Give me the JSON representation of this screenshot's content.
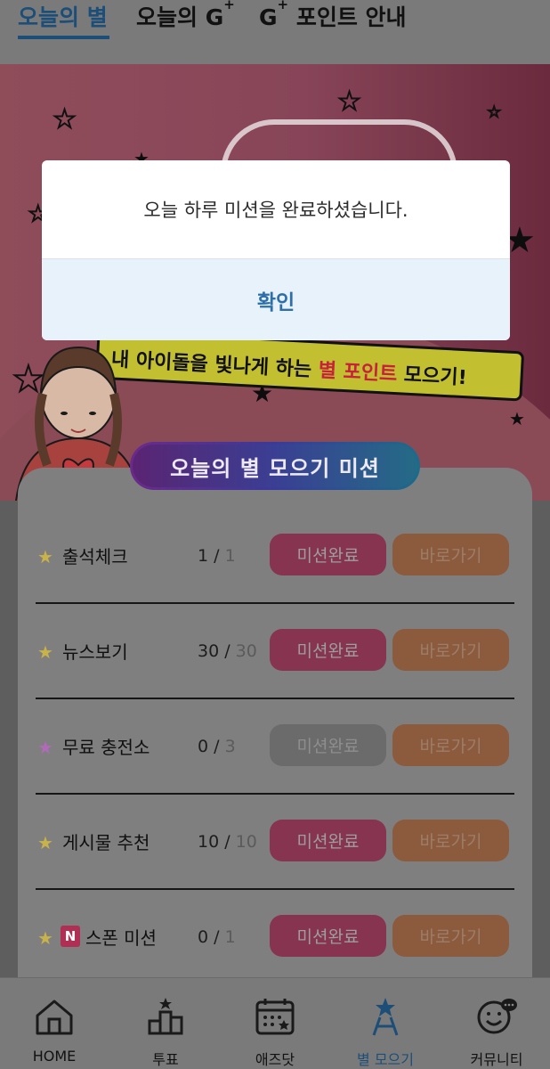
{
  "top_tabs": [
    {
      "label": "오늘의 별",
      "sup": ""
    },
    {
      "label": "오늘의 G",
      "sup": "+"
    },
    {
      "label": "G",
      "sup": "+",
      "suffix": " 포인트 안내"
    }
  ],
  "banner": {
    "slogan_prefix": "내 아이돌을 빛나게 하는 ",
    "slogan_highlight": "별 포인트",
    "slogan_suffix": " 모으기!"
  },
  "mission_card": {
    "title": "오늘의 별 모으기 미션",
    "missions": [
      {
        "name": "출석체크",
        "badge": "",
        "done": "1",
        "total": "1",
        "done_label": "미션완료",
        "go_label": "바로가기",
        "completed": true
      },
      {
        "name": "뉴스보기",
        "badge": "",
        "done": "30",
        "total": "30",
        "done_label": "미션완료",
        "go_label": "바로가기",
        "completed": true
      },
      {
        "name": "무료 충전소",
        "badge": "",
        "done": "0",
        "total": "3",
        "done_label": "미션완료",
        "go_label": "바로가기",
        "completed": false
      },
      {
        "name": "게시물 추천",
        "badge": "",
        "done": "10",
        "total": "10",
        "done_label": "미션완료",
        "go_label": "바로가기",
        "completed": true
      },
      {
        "name": "스폰 미션",
        "badge": "N",
        "done": "0",
        "total": "1",
        "done_label": "미션완료",
        "go_label": "바로가기",
        "completed": true
      }
    ]
  },
  "bottom_nav": [
    {
      "label": "HOME",
      "icon": "home-icon"
    },
    {
      "label": "투표",
      "icon": "vote-icon"
    },
    {
      "label": "애즈닷",
      "icon": "calendar-icon"
    },
    {
      "label": "별 모으기",
      "icon": "star-tower-icon",
      "active": true
    },
    {
      "label": "커뮤니티",
      "icon": "community-icon"
    }
  ],
  "modal": {
    "message": "오늘 하루 미션을 완료하셨습니다.",
    "confirm_label": "확인"
  },
  "colors": {
    "accent": "#1c4e78",
    "mission_done": "#86344f",
    "mission_go": "#8c5a3d",
    "modal_button_bg": "#e8f2fb",
    "modal_button_text": "#2f6fa8"
  }
}
